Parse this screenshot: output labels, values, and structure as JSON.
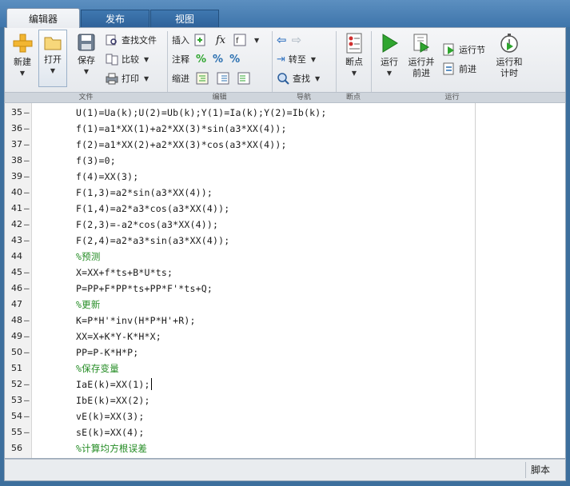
{
  "tabs": [
    {
      "label": "编辑器",
      "active": true
    },
    {
      "label": "发布",
      "active": false
    },
    {
      "label": "视图",
      "active": false
    }
  ],
  "ribbon": {
    "sections": {
      "file": "文件",
      "edit": "编辑",
      "navigate": "导航",
      "breakpoints": "断点",
      "run": "运行"
    },
    "file": {
      "new_label": "新建",
      "open_label": "打开",
      "save_label": "保存",
      "find_files_label": "查找文件",
      "compare_label": "比较",
      "print_label": "打印"
    },
    "edit": {
      "insert_label": "插入",
      "comment_label": "注释",
      "indent_label": "缩进",
      "fx_label": "fx"
    },
    "navigate": {
      "goto_label": "转至",
      "find_label": "查找"
    },
    "breakpoints": {
      "breakpoints_label": "断点"
    },
    "run": {
      "run_label": "运行",
      "run_advance_label_1": "运行并",
      "run_advance_label_2": "前进",
      "run_section_label": "运行节",
      "advance_label": "前进",
      "run_time_label_1": "运行和",
      "run_time_label_2": "计时"
    }
  },
  "colors": {
    "accent": "#3e75ab",
    "comment": "#228b22",
    "run_green": "#2fa52f"
  },
  "editor": {
    "lines": [
      {
        "n": "35",
        "code": "U(1)=Ua(k);U(2)=Ub(k);Y(1)=Ia(k);Y(2)=Ib(k);",
        "comment": false
      },
      {
        "n": "36",
        "code": "f(1)=a1*XX(1)+a2*XX(3)*sin(a3*XX(4));",
        "comment": false
      },
      {
        "n": "37",
        "code": "f(2)=a1*XX(2)+a2*XX(3)*cos(a3*XX(4));",
        "comment": false
      },
      {
        "n": "38",
        "code": "f(3)=0;",
        "comment": false
      },
      {
        "n": "39",
        "code": "f(4)=XX(3);",
        "comment": false
      },
      {
        "n": "40",
        "code": "F(1,3)=a2*sin(a3*XX(4));",
        "comment": false
      },
      {
        "n": "41",
        "code": "F(1,4)=a2*a3*cos(a3*XX(4));",
        "comment": false
      },
      {
        "n": "42",
        "code": "F(2,3)=-a2*cos(a3*XX(4));",
        "comment": false
      },
      {
        "n": "43",
        "code": "F(2,4)=a2*a3*sin(a3*XX(4));",
        "comment": false
      },
      {
        "n": "44",
        "code": "%预测",
        "comment": true
      },
      {
        "n": "45",
        "code": "X=XX+f*ts+B*U*ts;",
        "comment": false
      },
      {
        "n": "46",
        "code": "P=PP+F*PP*ts+PP*F'*ts+Q;",
        "comment": false
      },
      {
        "n": "47",
        "code": "%更新",
        "comment": true
      },
      {
        "n": "48",
        "code": "K=P*H'*inv(H*P*H'+R);",
        "comment": false
      },
      {
        "n": "49",
        "code": "XX=X+K*Y-K*H*X;",
        "comment": false
      },
      {
        "n": "50",
        "code": "PP=P-K*H*P;",
        "comment": false
      },
      {
        "n": "51",
        "code": "%保存变量",
        "comment": true
      },
      {
        "n": "52",
        "code": "IaE(k)=XX(1);",
        "comment": false
      },
      {
        "n": "53",
        "code": "IbE(k)=XX(2);",
        "comment": false
      },
      {
        "n": "54",
        "code": "vE(k)=XX(3);",
        "comment": false
      },
      {
        "n": "55",
        "code": "sE(k)=XX(4);",
        "comment": false
      },
      {
        "n": "56",
        "code": "%计算均方根误差",
        "comment": true
      }
    ]
  },
  "status": {
    "mode": "脚本"
  }
}
